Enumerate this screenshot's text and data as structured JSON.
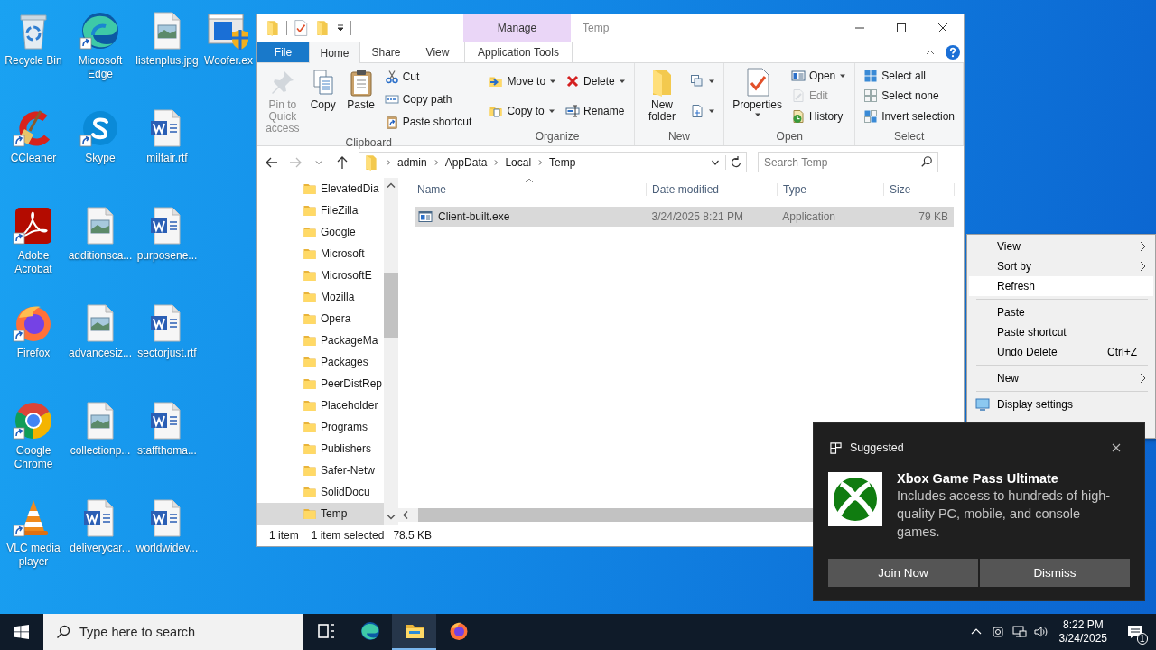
{
  "desktop_icons": [
    {
      "label": "Recycle Bin",
      "kind": "recycle-bin",
      "shortcut": false
    },
    {
      "label": "CCleaner",
      "kind": "ccleaner",
      "shortcut": true
    },
    {
      "label": "Adobe Acrobat",
      "kind": "acrobat",
      "shortcut": true
    },
    {
      "label": "Firefox",
      "kind": "firefox",
      "shortcut": true
    },
    {
      "label": "Google Chrome",
      "kind": "chrome",
      "shortcut": true
    },
    {
      "label": "VLC media player",
      "kind": "vlc",
      "shortcut": true
    },
    {
      "label": "Microsoft Edge",
      "kind": "edge",
      "shortcut": true
    },
    {
      "label": "Skype",
      "kind": "skype",
      "shortcut": true
    },
    {
      "label": "additionsca...",
      "kind": "image",
      "shortcut": false
    },
    {
      "label": "advancesiz...",
      "kind": "image",
      "shortcut": false
    },
    {
      "label": "collectionp...",
      "kind": "image",
      "shortcut": false
    },
    {
      "label": "deliverycar...",
      "kind": "word",
      "shortcut": false
    },
    {
      "label": "listenplus.jpg",
      "kind": "image",
      "shortcut": false
    },
    {
      "label": "milfair.rtf",
      "kind": "word",
      "shortcut": false
    },
    {
      "label": "purposene...",
      "kind": "word",
      "shortcut": false
    },
    {
      "label": "sectorjust.rtf",
      "kind": "word",
      "shortcut": false
    },
    {
      "label": "staffthoma...",
      "kind": "word",
      "shortcut": false
    },
    {
      "label": "worldwidev...",
      "kind": "word",
      "shortcut": false
    },
    {
      "label": "Woofer.ex",
      "kind": "installer",
      "shortcut": false
    }
  ],
  "explorer": {
    "title": "Temp",
    "context_tab": "Manage",
    "tabs": [
      {
        "label": "File",
        "kind": "file",
        "selected": false
      },
      {
        "label": "Home",
        "kind": "normal",
        "selected": true
      },
      {
        "label": "Share",
        "kind": "normal",
        "selected": false
      },
      {
        "label": "View",
        "kind": "normal",
        "selected": false
      },
      {
        "label": "Application Tools",
        "kind": "context",
        "selected": false
      }
    ],
    "ribbon": [
      {
        "name": "Clipboard",
        "columns": [
          {
            "kind": "large",
            "items": [
              {
                "label": "Pin to Quick access",
                "kind": "pin",
                "dropdown": false,
                "disabled": true
              }
            ]
          },
          {
            "kind": "large",
            "items": [
              {
                "label": "Copy",
                "kind": "copy",
                "dropdown": false,
                "disabled": false
              }
            ]
          },
          {
            "kind": "large",
            "items": [
              {
                "label": "Paste",
                "kind": "paste",
                "dropdown": false,
                "disabled": false
              }
            ]
          },
          {
            "kind": "small",
            "items": [
              {
                "label": "Cut",
                "kind": "cut",
                "dropdown": false,
                "disabled": false
              },
              {
                "label": "Copy path",
                "kind": "copy-path",
                "dropdown": false,
                "disabled": false
              },
              {
                "label": "Paste shortcut",
                "kind": "paste-shortcut",
                "dropdown": false,
                "disabled": false
              }
            ]
          }
        ]
      },
      {
        "name": "Organize",
        "columns": [
          {
            "kind": "small",
            "items": [
              {
                "label": "Move to",
                "kind": "move",
                "dropdown": true,
                "disabled": false
              },
              {
                "label": "Copy to",
                "kind": "copy-to",
                "dropdown": true,
                "disabled": false
              }
            ]
          },
          {
            "kind": "small",
            "items": [
              {
                "label": "Delete",
                "kind": "delete",
                "dropdown": true,
                "disabled": false
              },
              {
                "label": "Rename",
                "kind": "rename",
                "dropdown": false,
                "disabled": false
              }
            ]
          }
        ]
      },
      {
        "name": "New",
        "columns": [
          {
            "kind": "large",
            "items": [
              {
                "label": "New folder",
                "kind": "folder",
                "dropdown": false,
                "disabled": false
              }
            ]
          },
          {
            "kind": "small",
            "items": [
              {
                "kind": "new-item",
                "dropdown": true,
                "disabled": false
              },
              {
                "kind": "easy-access",
                "dropdown": true,
                "disabled": false
              }
            ]
          }
        ]
      },
      {
        "name": "Open",
        "columns": [
          {
            "kind": "large",
            "items": [
              {
                "label": "Properties",
                "kind": "properties",
                "dropdown": true,
                "disabled": false
              }
            ]
          },
          {
            "kind": "small",
            "items": [
              {
                "label": "Open",
                "kind": "open",
                "dropdown": true,
                "disabled": false
              },
              {
                "label": "Edit",
                "kind": "edit",
                "dropdown": false,
                "disabled": true
              },
              {
                "label": "History",
                "kind": "history",
                "dropdown": false,
                "disabled": false
              }
            ]
          }
        ]
      },
      {
        "name": "Select",
        "columns": [
          {
            "kind": "small",
            "items": [
              {
                "label": "Select all",
                "kind": "select-all",
                "dropdown": false,
                "disabled": false
              },
              {
                "label": "Select none",
                "kind": "select-none",
                "dropdown": false,
                "disabled": false
              },
              {
                "label": "Invert selection",
                "kind": "invert",
                "dropdown": false,
                "disabled": false
              }
            ]
          }
        ]
      }
    ],
    "address": [
      "admin",
      "AppData",
      "Local",
      "Temp"
    ],
    "search": {
      "placeholder": "Search Temp"
    },
    "nav_pane": [
      {
        "label": "ElevatedDia",
        "selected": false
      },
      {
        "label": "FileZilla",
        "selected": false
      },
      {
        "label": "Google",
        "selected": false
      },
      {
        "label": "Microsoft",
        "selected": false
      },
      {
        "label": "MicrosoftE",
        "selected": false
      },
      {
        "label": "Mozilla",
        "selected": false
      },
      {
        "label": "Opera",
        "selected": false
      },
      {
        "label": "PackageMa",
        "selected": false
      },
      {
        "label": "Packages",
        "selected": false
      },
      {
        "label": "PeerDistRep",
        "selected": false
      },
      {
        "label": "Placeholder",
        "selected": false
      },
      {
        "label": "Programs",
        "selected": false
      },
      {
        "label": "Publishers",
        "selected": false
      },
      {
        "label": "Safer-Netw",
        "selected": false
      },
      {
        "label": "SolidDocu",
        "selected": false
      },
      {
        "label": "Temp",
        "selected": true
      }
    ],
    "columns": [
      "Name",
      "Date modified",
      "Type",
      "Size"
    ],
    "files": [
      {
        "name": "Client-built.exe",
        "date_modified": "3/24/2025 8:21 PM",
        "type": "Application",
        "size": "79 KB",
        "selected": true
      }
    ],
    "status_bar": {
      "items": "1 item",
      "selection": "1 item selected",
      "selection_size": "78.5 KB"
    }
  },
  "context_menu": [
    {
      "kind": "item",
      "label": "View",
      "submenu": true,
      "selected": false
    },
    {
      "kind": "item",
      "label": "Sort by",
      "submenu": true,
      "selected": false
    },
    {
      "kind": "item",
      "label": "Refresh",
      "submenu": false,
      "selected": true
    },
    {
      "kind": "separator"
    },
    {
      "kind": "item",
      "label": "Paste",
      "submenu": false,
      "selected": false
    },
    {
      "kind": "item",
      "label": "Paste shortcut",
      "submenu": false,
      "selected": false
    },
    {
      "kind": "item",
      "label": "Undo Delete",
      "shortcut": "Ctrl+Z",
      "submenu": false,
      "selected": false
    },
    {
      "kind": "separator"
    },
    {
      "kind": "item",
      "label": "New",
      "submenu": true,
      "selected": false
    },
    {
      "kind": "separator"
    },
    {
      "kind": "display-item",
      "label": "Display settings",
      "submenu": false,
      "selected": false
    }
  ],
  "notification": {
    "header": "Suggested",
    "title": "Xbox Game Pass Ultimate",
    "body": "Includes access to hundreds of high-quality PC, mobile, and console games.",
    "buttons": [
      "Join Now",
      "Dismiss"
    ]
  },
  "taskbar": {
    "search_placeholder": "Type here to search",
    "apps": [
      {
        "kind": "task-view",
        "active": false
      },
      {
        "kind": "edge",
        "active": false
      },
      {
        "kind": "explorer",
        "active": true
      },
      {
        "kind": "firefox",
        "active": false
      }
    ],
    "time": "8:22 PM",
    "date": "3/24/2025",
    "notification_count": "1"
  }
}
